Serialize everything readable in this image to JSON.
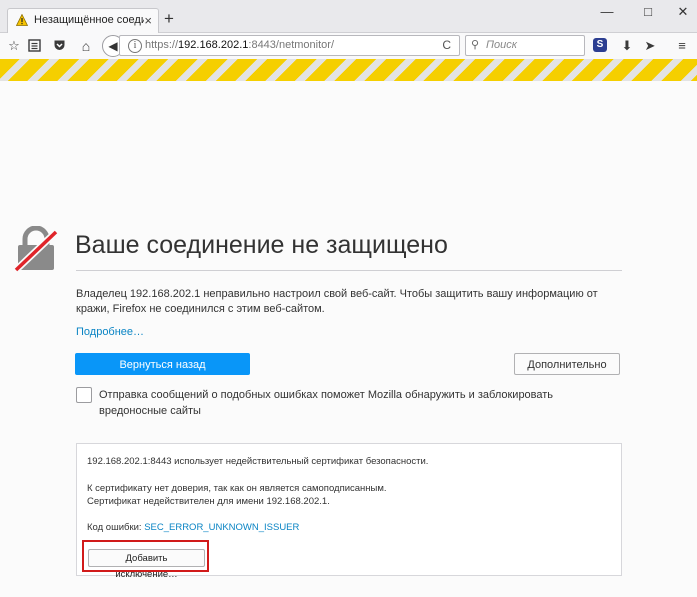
{
  "browser": {
    "tab": {
      "title": "Незащищённое соедине",
      "close": "×",
      "warn_icon": "warning-triangle-icon"
    },
    "new_tab": "+",
    "window_controls": {
      "minimize": "—",
      "maximize": "□",
      "close": "✕"
    },
    "urlbar": {
      "scheme": "https://",
      "host": "192.168.202.1",
      "rest": ":8443/netmonitor/",
      "reload": "C"
    },
    "search": {
      "placeholder": "Поиск"
    },
    "extension_label": "S",
    "colors": {
      "stripe_yellow": "#f5cf00",
      "primary_button": "#0996f8",
      "link": "#0a84c4",
      "highlight": "#d11a1a"
    }
  },
  "error_page": {
    "title": "Ваше соединение не защищено",
    "description": "Владелец 192.168.202.1 неправильно настроил свой веб-сайт. Чтобы защитить вашу информацию от кражи, Firefox не соединился с этим веб-сайтом.",
    "more_link": "Подробнее…",
    "go_back_button": "Вернуться назад",
    "advanced_button": "Дополнительно",
    "report_checkbox_label": "Отправка сообщений о подобных ошибках поможет Mozilla обнаружить и заблокировать вредоносные сайты",
    "details": {
      "line1": "192.168.202.1:8443 использует недействительный сертификат безопасности.",
      "line2": "К сертификату нет доверия, так как он является самоподписанным.",
      "line3": "Сертификат недействителен для имени 192.168.202.1.",
      "error_code_label": "Код ошибки: ",
      "error_code": "SEC_ERROR_UNKNOWN_ISSUER",
      "add_exception_button": "Добавить исключение…"
    }
  }
}
